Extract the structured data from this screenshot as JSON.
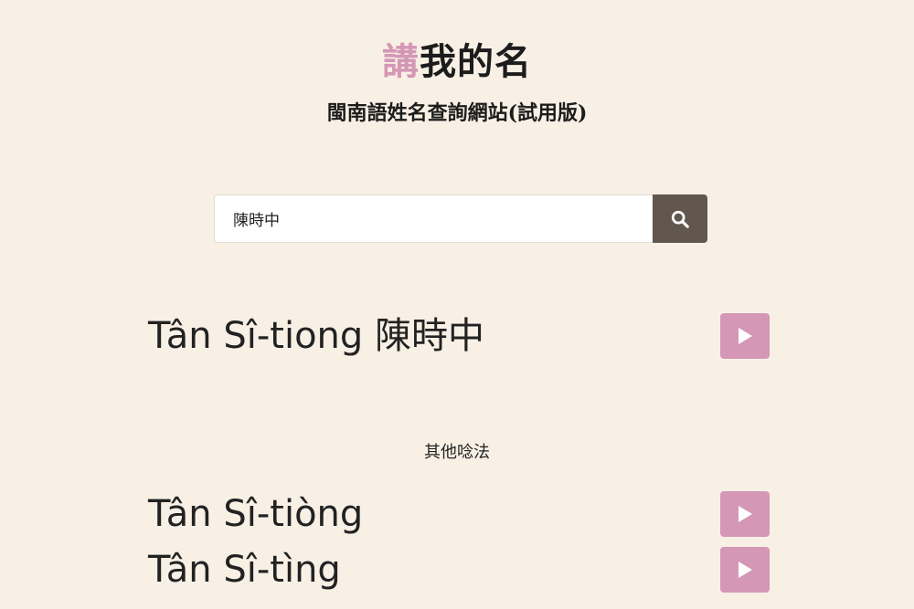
{
  "header": {
    "logo_accent": "講",
    "logo_rest": "我的名",
    "subtitle": "閩南語姓名查詢網站(試用版)"
  },
  "search": {
    "value": "陳時中",
    "button_icon": "search-icon"
  },
  "main_result": {
    "text": "Tân Sî-tiong 陳時中",
    "play_icon": "play-icon"
  },
  "alternatives": {
    "heading": "其他唸法",
    "items": [
      {
        "text": "Tân Sî-tiòng",
        "play_icon": "play-icon"
      },
      {
        "text": "Tân Sî-tìng",
        "play_icon": "play-icon"
      }
    ]
  },
  "colors": {
    "background": "#f8f0e5",
    "accent": "#d497b6",
    "search_button": "#62574d",
    "text": "#222222"
  }
}
